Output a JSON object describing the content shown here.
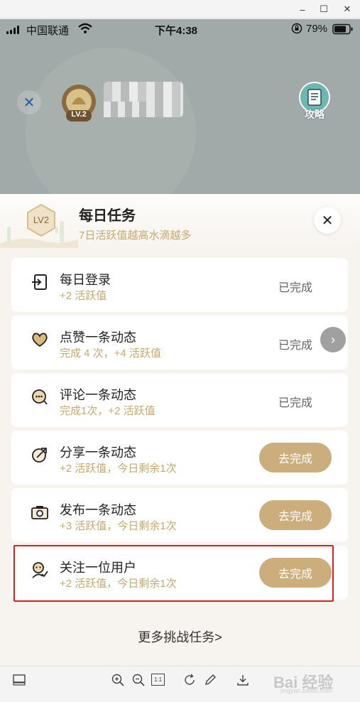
{
  "window": {
    "minimize_icon": "minimize-icon",
    "maximize_icon": "maximize-icon",
    "close_icon": "close-icon",
    "minimize": "–",
    "maximize": "☐",
    "close": "✕"
  },
  "status_bar": {
    "carrier": "中国联通",
    "time": "下午4:38",
    "battery": "79%"
  },
  "profile": {
    "level_badge": "LV.2",
    "guide_label": "攻略"
  },
  "sheet": {
    "level": "LV2",
    "title": "每日任务",
    "subtitle": "7日活跃值越高水滴越多",
    "close_symbol": "✕"
  },
  "tasks": [
    {
      "icon": "login-icon",
      "title": "每日登录",
      "sub": "+2 活跃值",
      "status": "已完成"
    },
    {
      "icon": "like-heart-icon",
      "title": "点赞一条动态",
      "sub": "完成 4 次，+4 活跃值",
      "status": "已完成"
    },
    {
      "icon": "comment-icon",
      "title": "评论一条动态",
      "sub": "完成1次，+2 活跃值",
      "status": "已完成"
    },
    {
      "icon": "share-icon",
      "title": "分享一条动态",
      "sub": "+2 活跃值，今日剩余1次",
      "action": "去完成"
    },
    {
      "icon": "camera-icon",
      "title": "发布一条动态",
      "sub": "+3 活跃值，今日剩余1次",
      "action": "去完成"
    },
    {
      "icon": "follow-user-icon",
      "title": "关注一位用户",
      "sub": "+2 活跃值，今日剩余1次",
      "action": "去完成"
    }
  ],
  "more_tasks": "更多挑战任务>",
  "toolbar": {
    "fit_label": "1:1",
    "watermark": "Bai 经验",
    "watermark_sub": "jingyan.baidu.com"
  },
  "colors": {
    "accent_gold": "#cbae7b",
    "subtitle_gold": "#c9a76b",
    "highlight_red": "#e01e1e"
  }
}
